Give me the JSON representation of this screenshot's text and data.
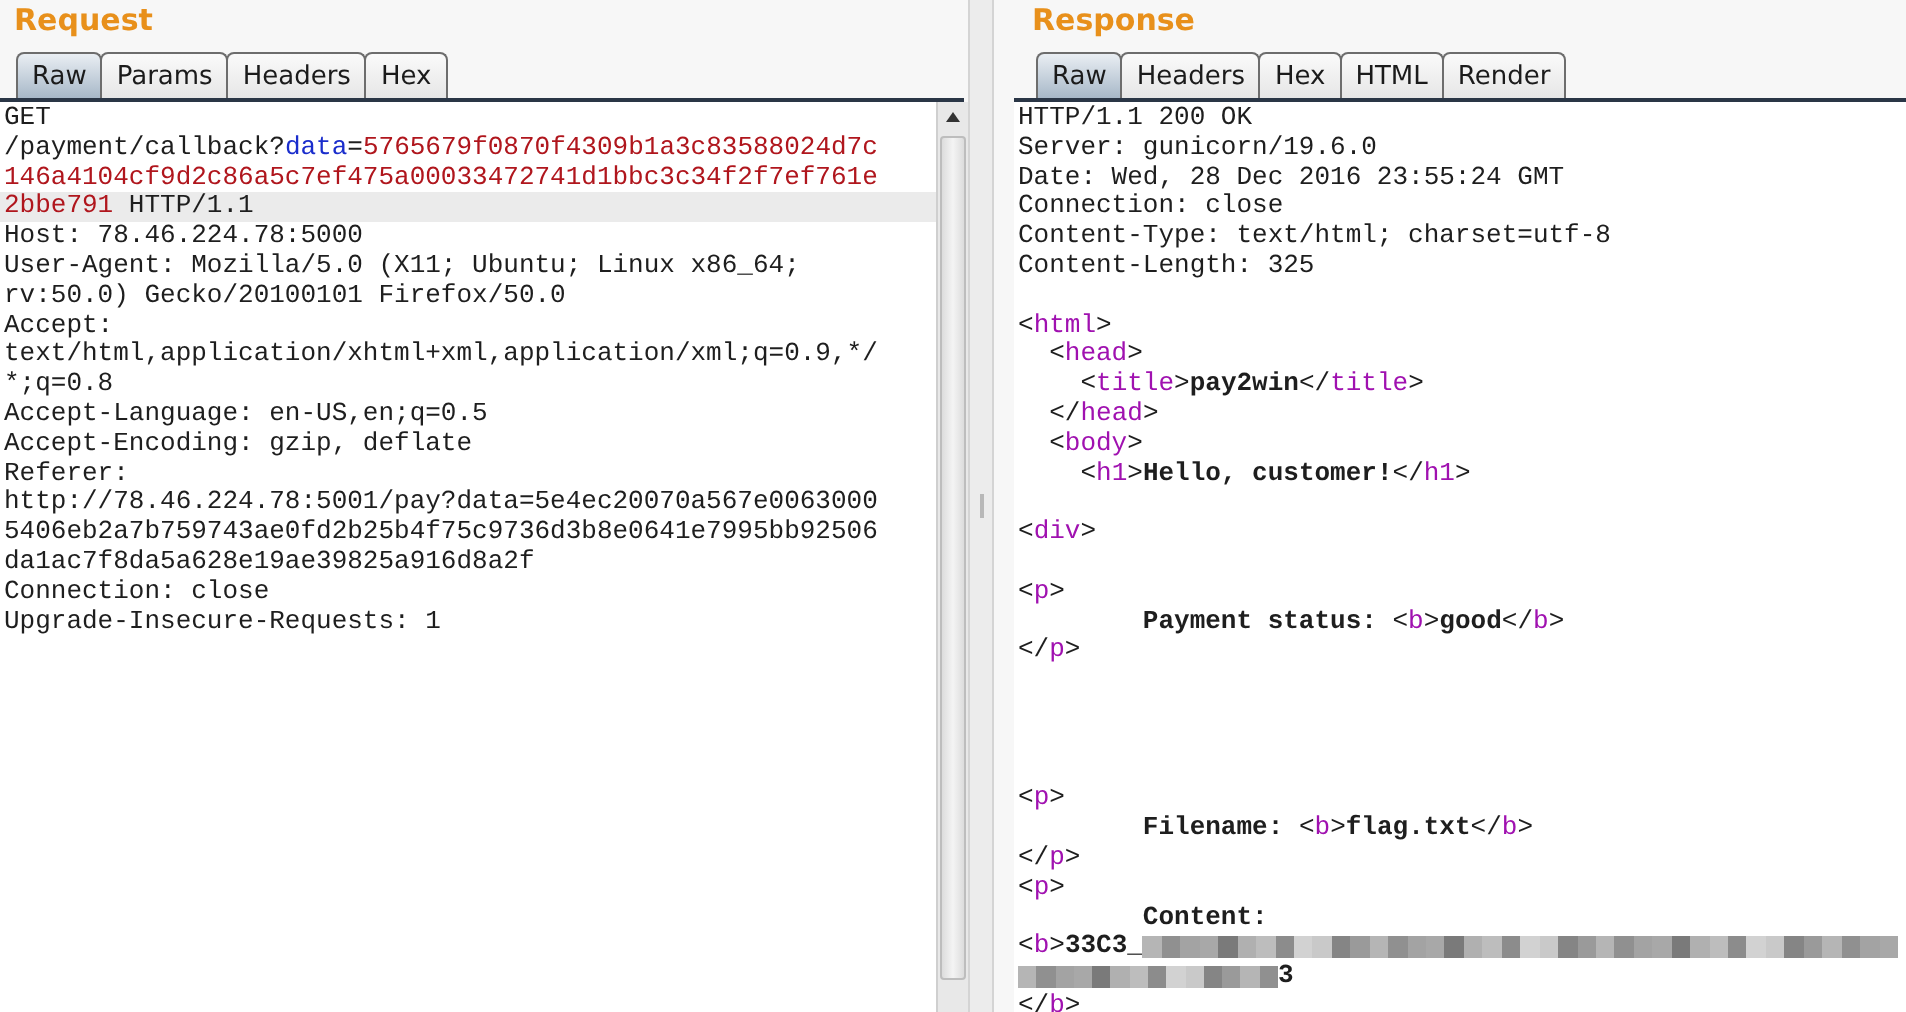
{
  "request": {
    "title": "Request",
    "tabs": [
      {
        "label": "Raw",
        "selected": true
      },
      {
        "label": "Params",
        "selected": false
      },
      {
        "label": "Headers",
        "selected": false
      },
      {
        "label": "Hex",
        "selected": false
      }
    ],
    "lines": [
      {
        "kind": "code",
        "selected": false,
        "segments": [
          {
            "kind": "text",
            "text": "GET"
          }
        ]
      },
      {
        "kind": "code",
        "selected": false,
        "segments": [
          {
            "kind": "text",
            "text": "/payment/callback?"
          },
          {
            "kind": "param",
            "text": "data"
          },
          {
            "kind": "text",
            "text": "="
          },
          {
            "kind": "value",
            "text": "5765679f0870f4309b1a3c83588024d7c"
          }
        ]
      },
      {
        "kind": "code",
        "selected": false,
        "segments": [
          {
            "kind": "value",
            "text": "146a4104cf9d2c86a5c7ef475a00033472741d1bbc3c34f2f7ef761e"
          }
        ]
      },
      {
        "kind": "code",
        "selected": true,
        "segments": [
          {
            "kind": "value",
            "text": "2bbe791"
          },
          {
            "kind": "text",
            "text": " HTTP/1.1"
          }
        ]
      },
      {
        "kind": "code",
        "selected": false,
        "segments": [
          {
            "kind": "text",
            "text": "Host: 78.46.224.78:5000"
          }
        ]
      },
      {
        "kind": "code",
        "selected": false,
        "segments": [
          {
            "kind": "text",
            "text": "User-Agent: Mozilla/5.0 (X11; Ubuntu; Linux x86_64;"
          }
        ]
      },
      {
        "kind": "code",
        "selected": false,
        "segments": [
          {
            "kind": "text",
            "text": "rv:50.0) Gecko/20100101 Firefox/50.0"
          }
        ]
      },
      {
        "kind": "code",
        "selected": false,
        "segments": [
          {
            "kind": "text",
            "text": "Accept:"
          }
        ]
      },
      {
        "kind": "code",
        "selected": false,
        "segments": [
          {
            "kind": "text",
            "text": "text/html,application/xhtml+xml,application/xml;q=0.9,*/"
          }
        ]
      },
      {
        "kind": "code",
        "selected": false,
        "segments": [
          {
            "kind": "text",
            "text": "*;q=0.8"
          }
        ]
      },
      {
        "kind": "code",
        "selected": false,
        "segments": [
          {
            "kind": "text",
            "text": "Accept-Language: en-US,en;q=0.5"
          }
        ]
      },
      {
        "kind": "code",
        "selected": false,
        "segments": [
          {
            "kind": "text",
            "text": "Accept-Encoding: gzip, deflate"
          }
        ]
      },
      {
        "kind": "code",
        "selected": false,
        "segments": [
          {
            "kind": "text",
            "text": "Referer:"
          }
        ]
      },
      {
        "kind": "code",
        "selected": false,
        "segments": [
          {
            "kind": "text",
            "text": "http://78.46.224.78:5001/pay?data=5e4ec20070a567e0063000"
          }
        ]
      },
      {
        "kind": "code",
        "selected": false,
        "segments": [
          {
            "kind": "text",
            "text": "5406eb2a7b759743ae0fd2b25b4f75c9736d3b8e0641e7995bb92506"
          }
        ]
      },
      {
        "kind": "code",
        "selected": false,
        "segments": [
          {
            "kind": "text",
            "text": "da1ac7f8da5a628e19ae39825a916d8a2f"
          }
        ]
      },
      {
        "kind": "code",
        "selected": false,
        "segments": [
          {
            "kind": "text",
            "text": "Connection: close"
          }
        ]
      },
      {
        "kind": "code",
        "selected": false,
        "segments": [
          {
            "kind": "text",
            "text": "Upgrade-Insecure-Requests: 1"
          }
        ]
      }
    ]
  },
  "response": {
    "title": "Response",
    "tabs": [
      {
        "label": "Raw",
        "selected": true
      },
      {
        "label": "Headers",
        "selected": false
      },
      {
        "label": "Hex",
        "selected": false
      },
      {
        "label": "HTML",
        "selected": false
      },
      {
        "label": "Render",
        "selected": false
      }
    ],
    "lines": [
      {
        "kind": "code",
        "segments": [
          {
            "kind": "text",
            "text": "HTTP/1.1 200 OK"
          }
        ]
      },
      {
        "kind": "code",
        "segments": [
          {
            "kind": "text",
            "text": "Server: gunicorn/19.6.0"
          }
        ]
      },
      {
        "kind": "code",
        "segments": [
          {
            "kind": "text",
            "text": "Date: Wed, 28 Dec 2016 23:55:24 GMT"
          }
        ]
      },
      {
        "kind": "code",
        "segments": [
          {
            "kind": "text",
            "text": "Connection: close"
          }
        ]
      },
      {
        "kind": "code",
        "segments": [
          {
            "kind": "text",
            "text": "Content-Type: text/html; charset=utf-8"
          }
        ]
      },
      {
        "kind": "code",
        "segments": [
          {
            "kind": "text",
            "text": "Content-Length: 325"
          }
        ]
      },
      {
        "kind": "blank"
      },
      {
        "kind": "code",
        "segments": [
          {
            "kind": "text",
            "text": "<"
          },
          {
            "kind": "tag",
            "text": "html"
          },
          {
            "kind": "text",
            "text": ">"
          }
        ]
      },
      {
        "kind": "code",
        "segments": [
          {
            "kind": "text",
            "text": "  <"
          },
          {
            "kind": "tag",
            "text": "head"
          },
          {
            "kind": "text",
            "text": ">"
          }
        ]
      },
      {
        "kind": "code",
        "segments": [
          {
            "kind": "text",
            "text": "    <"
          },
          {
            "kind": "tag",
            "text": "title"
          },
          {
            "kind": "text",
            "text": ">"
          },
          {
            "kind": "bold",
            "text": "pay2win"
          },
          {
            "kind": "text",
            "text": "</"
          },
          {
            "kind": "tag",
            "text": "title"
          },
          {
            "kind": "text",
            "text": ">"
          }
        ]
      },
      {
        "kind": "code",
        "segments": [
          {
            "kind": "text",
            "text": "  </"
          },
          {
            "kind": "tag",
            "text": "head"
          },
          {
            "kind": "text",
            "text": ">"
          }
        ]
      },
      {
        "kind": "code",
        "segments": [
          {
            "kind": "text",
            "text": "  <"
          },
          {
            "kind": "tag",
            "text": "body"
          },
          {
            "kind": "text",
            "text": ">"
          }
        ]
      },
      {
        "kind": "code",
        "segments": [
          {
            "kind": "text",
            "text": "    <"
          },
          {
            "kind": "tag",
            "text": "h1"
          },
          {
            "kind": "text",
            "text": ">"
          },
          {
            "kind": "bold",
            "text": "Hello, customer!"
          },
          {
            "kind": "text",
            "text": "</"
          },
          {
            "kind": "tag",
            "text": "h1"
          },
          {
            "kind": "text",
            "text": ">"
          }
        ]
      },
      {
        "kind": "blank"
      },
      {
        "kind": "code",
        "segments": [
          {
            "kind": "text",
            "text": "<"
          },
          {
            "kind": "tag",
            "text": "div"
          },
          {
            "kind": "text",
            "text": ">"
          }
        ]
      },
      {
        "kind": "blank"
      },
      {
        "kind": "code",
        "segments": [
          {
            "kind": "text",
            "text": "<"
          },
          {
            "kind": "tag",
            "text": "p"
          },
          {
            "kind": "text",
            "text": ">"
          }
        ]
      },
      {
        "kind": "code",
        "segments": [
          {
            "kind": "bold",
            "text": "        Payment status: "
          },
          {
            "kind": "text",
            "text": "<"
          },
          {
            "kind": "tag",
            "text": "b"
          },
          {
            "kind": "text",
            "text": ">"
          },
          {
            "kind": "bold",
            "text": "good"
          },
          {
            "kind": "text",
            "text": "</"
          },
          {
            "kind": "tag",
            "text": "b"
          },
          {
            "kind": "text",
            "text": ">"
          }
        ]
      },
      {
        "kind": "code",
        "segments": [
          {
            "kind": "text",
            "text": "</"
          },
          {
            "kind": "tag",
            "text": "p"
          },
          {
            "kind": "text",
            "text": ">"
          }
        ]
      },
      {
        "kind": "blank"
      },
      {
        "kind": "blank"
      },
      {
        "kind": "blank"
      },
      {
        "kind": "blank"
      },
      {
        "kind": "code",
        "segments": [
          {
            "kind": "text",
            "text": "<"
          },
          {
            "kind": "tag",
            "text": "p"
          },
          {
            "kind": "text",
            "text": ">"
          }
        ]
      },
      {
        "kind": "code",
        "segments": [
          {
            "kind": "bold",
            "text": "        Filename: "
          },
          {
            "kind": "text",
            "text": "<"
          },
          {
            "kind": "tag",
            "text": "b"
          },
          {
            "kind": "text",
            "text": ">"
          },
          {
            "kind": "bold",
            "text": "flag.txt"
          },
          {
            "kind": "text",
            "text": "</"
          },
          {
            "kind": "tag",
            "text": "b"
          },
          {
            "kind": "text",
            "text": ">"
          }
        ]
      },
      {
        "kind": "code",
        "segments": [
          {
            "kind": "text",
            "text": "</"
          },
          {
            "kind": "tag",
            "text": "p"
          },
          {
            "kind": "text",
            "text": ">"
          }
        ]
      },
      {
        "kind": "code",
        "segments": [
          {
            "kind": "text",
            "text": "<"
          },
          {
            "kind": "tag",
            "text": "p"
          },
          {
            "kind": "text",
            "text": ">"
          }
        ]
      },
      {
        "kind": "code",
        "segments": [
          {
            "kind": "bold",
            "text": "        Content:"
          }
        ]
      },
      {
        "kind": "code",
        "segments": [
          {
            "kind": "text",
            "text": "<"
          },
          {
            "kind": "tag",
            "text": "b"
          },
          {
            "kind": "text",
            "text": ">"
          },
          {
            "kind": "bold",
            "text": "33C3_"
          },
          {
            "kind": "redacted"
          }
        ]
      },
      {
        "kind": "code",
        "segments": [
          {
            "kind": "redacted"
          },
          {
            "kind": "bold",
            "text": "3"
          }
        ]
      },
      {
        "kind": "code",
        "segments": [
          {
            "kind": "text",
            "text": "</"
          },
          {
            "kind": "tag",
            "text": "b"
          },
          {
            "kind": "text",
            "text": ">"
          }
        ]
      }
    ]
  }
}
